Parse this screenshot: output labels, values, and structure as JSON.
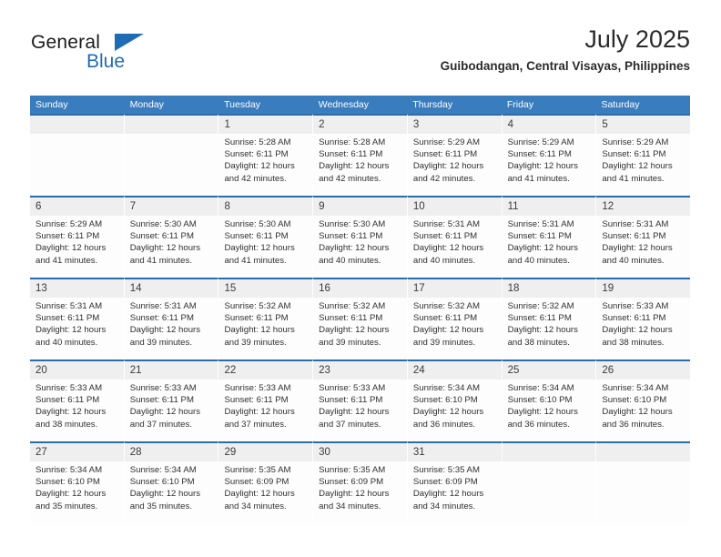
{
  "brand": {
    "name_top": "General",
    "name_bottom": "Blue",
    "triangle_color": "#1f6cb4",
    "text_color": "#1a1a1a"
  },
  "header": {
    "month_year": "July 2025",
    "location": "Guibodangan, Central Visayas, Philippines"
  },
  "theme": {
    "header_blue": "#3a7dbf",
    "cell_top_border": "#2c6ca8",
    "date_band": "#efefef",
    "cell_bg": "#fdfdfd"
  },
  "weekdays": [
    "Sunday",
    "Monday",
    "Tuesday",
    "Wednesday",
    "Thursday",
    "Friday",
    "Saturday"
  ],
  "weeks": [
    [
      {
        "date": "",
        "empty": true
      },
      {
        "date": "",
        "empty": true
      },
      {
        "date": "1",
        "sunrise": "Sunrise: 5:28 AM",
        "sunset": "Sunset: 6:11 PM",
        "daylight": "Daylight: 12 hours and 42 minutes."
      },
      {
        "date": "2",
        "sunrise": "Sunrise: 5:28 AM",
        "sunset": "Sunset: 6:11 PM",
        "daylight": "Daylight: 12 hours and 42 minutes."
      },
      {
        "date": "3",
        "sunrise": "Sunrise: 5:29 AM",
        "sunset": "Sunset: 6:11 PM",
        "daylight": "Daylight: 12 hours and 42 minutes."
      },
      {
        "date": "4",
        "sunrise": "Sunrise: 5:29 AM",
        "sunset": "Sunset: 6:11 PM",
        "daylight": "Daylight: 12 hours and 41 minutes."
      },
      {
        "date": "5",
        "sunrise": "Sunrise: 5:29 AM",
        "sunset": "Sunset: 6:11 PM",
        "daylight": "Daylight: 12 hours and 41 minutes."
      }
    ],
    [
      {
        "date": "6",
        "sunrise": "Sunrise: 5:29 AM",
        "sunset": "Sunset: 6:11 PM",
        "daylight": "Daylight: 12 hours and 41 minutes."
      },
      {
        "date": "7",
        "sunrise": "Sunrise: 5:30 AM",
        "sunset": "Sunset: 6:11 PM",
        "daylight": "Daylight: 12 hours and 41 minutes."
      },
      {
        "date": "8",
        "sunrise": "Sunrise: 5:30 AM",
        "sunset": "Sunset: 6:11 PM",
        "daylight": "Daylight: 12 hours and 41 minutes."
      },
      {
        "date": "9",
        "sunrise": "Sunrise: 5:30 AM",
        "sunset": "Sunset: 6:11 PM",
        "daylight": "Daylight: 12 hours and 40 minutes."
      },
      {
        "date": "10",
        "sunrise": "Sunrise: 5:31 AM",
        "sunset": "Sunset: 6:11 PM",
        "daylight": "Daylight: 12 hours and 40 minutes."
      },
      {
        "date": "11",
        "sunrise": "Sunrise: 5:31 AM",
        "sunset": "Sunset: 6:11 PM",
        "daylight": "Daylight: 12 hours and 40 minutes."
      },
      {
        "date": "12",
        "sunrise": "Sunrise: 5:31 AM",
        "sunset": "Sunset: 6:11 PM",
        "daylight": "Daylight: 12 hours and 40 minutes."
      }
    ],
    [
      {
        "date": "13",
        "sunrise": "Sunrise: 5:31 AM",
        "sunset": "Sunset: 6:11 PM",
        "daylight": "Daylight: 12 hours and 40 minutes."
      },
      {
        "date": "14",
        "sunrise": "Sunrise: 5:31 AM",
        "sunset": "Sunset: 6:11 PM",
        "daylight": "Daylight: 12 hours and 39 minutes."
      },
      {
        "date": "15",
        "sunrise": "Sunrise: 5:32 AM",
        "sunset": "Sunset: 6:11 PM",
        "daylight": "Daylight: 12 hours and 39 minutes."
      },
      {
        "date": "16",
        "sunrise": "Sunrise: 5:32 AM",
        "sunset": "Sunset: 6:11 PM",
        "daylight": "Daylight: 12 hours and 39 minutes."
      },
      {
        "date": "17",
        "sunrise": "Sunrise: 5:32 AM",
        "sunset": "Sunset: 6:11 PM",
        "daylight": "Daylight: 12 hours and 39 minutes."
      },
      {
        "date": "18",
        "sunrise": "Sunrise: 5:32 AM",
        "sunset": "Sunset: 6:11 PM",
        "daylight": "Daylight: 12 hours and 38 minutes."
      },
      {
        "date": "19",
        "sunrise": "Sunrise: 5:33 AM",
        "sunset": "Sunset: 6:11 PM",
        "daylight": "Daylight: 12 hours and 38 minutes."
      }
    ],
    [
      {
        "date": "20",
        "sunrise": "Sunrise: 5:33 AM",
        "sunset": "Sunset: 6:11 PM",
        "daylight": "Daylight: 12 hours and 38 minutes."
      },
      {
        "date": "21",
        "sunrise": "Sunrise: 5:33 AM",
        "sunset": "Sunset: 6:11 PM",
        "daylight": "Daylight: 12 hours and 37 minutes."
      },
      {
        "date": "22",
        "sunrise": "Sunrise: 5:33 AM",
        "sunset": "Sunset: 6:11 PM",
        "daylight": "Daylight: 12 hours and 37 minutes."
      },
      {
        "date": "23",
        "sunrise": "Sunrise: 5:33 AM",
        "sunset": "Sunset: 6:11 PM",
        "daylight": "Daylight: 12 hours and 37 minutes."
      },
      {
        "date": "24",
        "sunrise": "Sunrise: 5:34 AM",
        "sunset": "Sunset: 6:10 PM",
        "daylight": "Daylight: 12 hours and 36 minutes."
      },
      {
        "date": "25",
        "sunrise": "Sunrise: 5:34 AM",
        "sunset": "Sunset: 6:10 PM",
        "daylight": "Daylight: 12 hours and 36 minutes."
      },
      {
        "date": "26",
        "sunrise": "Sunrise: 5:34 AM",
        "sunset": "Sunset: 6:10 PM",
        "daylight": "Daylight: 12 hours and 36 minutes."
      }
    ],
    [
      {
        "date": "27",
        "sunrise": "Sunrise: 5:34 AM",
        "sunset": "Sunset: 6:10 PM",
        "daylight": "Daylight: 12 hours and 35 minutes."
      },
      {
        "date": "28",
        "sunrise": "Sunrise: 5:34 AM",
        "sunset": "Sunset: 6:10 PM",
        "daylight": "Daylight: 12 hours and 35 minutes."
      },
      {
        "date": "29",
        "sunrise": "Sunrise: 5:35 AM",
        "sunset": "Sunset: 6:09 PM",
        "daylight": "Daylight: 12 hours and 34 minutes."
      },
      {
        "date": "30",
        "sunrise": "Sunrise: 5:35 AM",
        "sunset": "Sunset: 6:09 PM",
        "daylight": "Daylight: 12 hours and 34 minutes."
      },
      {
        "date": "31",
        "sunrise": "Sunrise: 5:35 AM",
        "sunset": "Sunset: 6:09 PM",
        "daylight": "Daylight: 12 hours and 34 minutes."
      },
      {
        "date": "",
        "empty": true
      },
      {
        "date": "",
        "empty": true
      }
    ]
  ]
}
